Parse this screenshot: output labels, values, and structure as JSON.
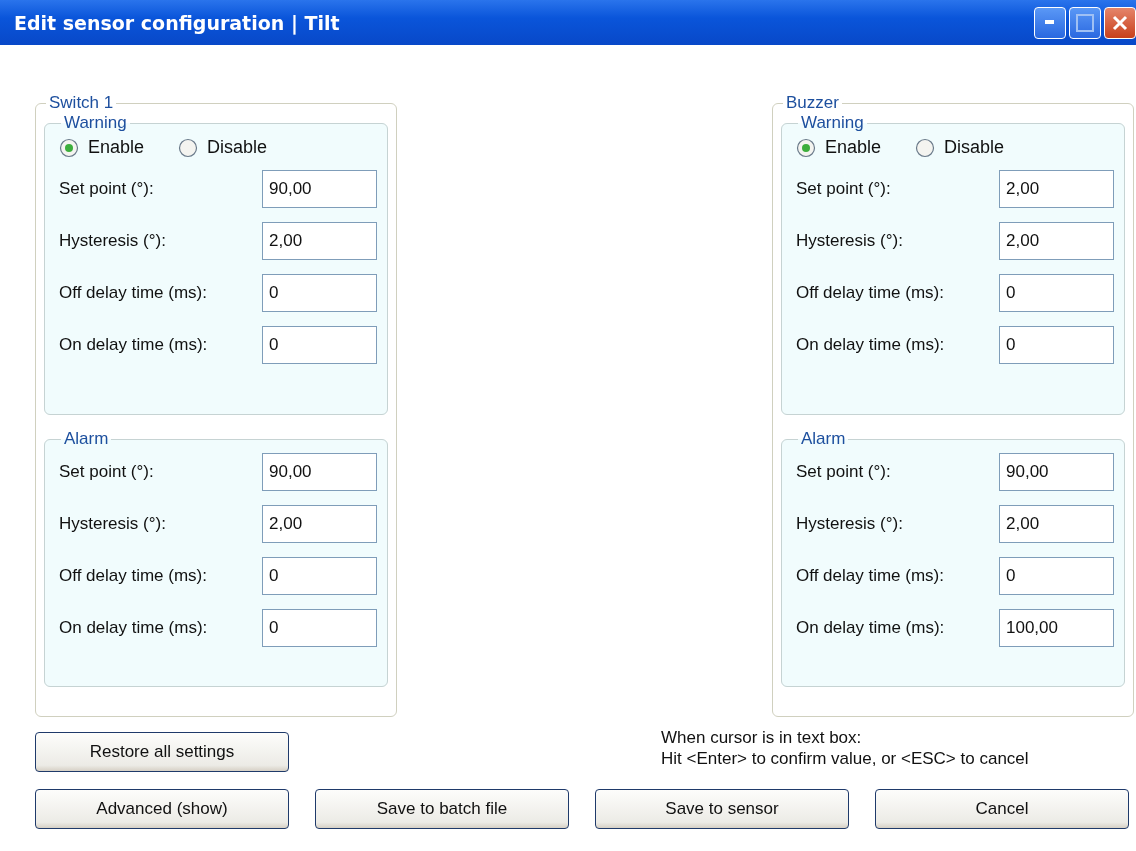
{
  "window": {
    "title": "Edit sensor configuration | Tilt"
  },
  "groups": [
    {
      "title": "Switch 1",
      "sections": [
        {
          "title": "Warning",
          "radios": [
            {
              "label": "Enable",
              "selected": true
            },
            {
              "label": "Disable",
              "selected": false
            }
          ],
          "fields": [
            {
              "label": "Set point (°):",
              "value": "90,00"
            },
            {
              "label": "Hysteresis (°):",
              "value": "2,00"
            },
            {
              "label": "Off delay time (ms):",
              "value": "0"
            },
            {
              "label": "On delay time (ms):",
              "value": "0"
            }
          ]
        },
        {
          "title": "Alarm",
          "fields": [
            {
              "label": "Set point (°):",
              "value": "90,00"
            },
            {
              "label": "Hysteresis (°):",
              "value": "2,00"
            },
            {
              "label": "Off delay time (ms):",
              "value": "0"
            },
            {
              "label": "On delay time (ms):",
              "value": "0"
            }
          ]
        }
      ]
    },
    {
      "title": "Buzzer",
      "sections": [
        {
          "title": "Warning",
          "radios": [
            {
              "label": "Enable",
              "selected": true
            },
            {
              "label": "Disable",
              "selected": false
            }
          ],
          "fields": [
            {
              "label": "Set point (°):",
              "value": "2,00"
            },
            {
              "label": "Hysteresis (°):",
              "value": "2,00"
            },
            {
              "label": "Off delay time (ms):",
              "value": "0"
            },
            {
              "label": "On delay time (ms):",
              "value": "0"
            }
          ]
        },
        {
          "title": "Alarm",
          "fields": [
            {
              "label": "Set point (°):",
              "value": "90,00"
            },
            {
              "label": "Hysteresis (°):",
              "value": "2,00"
            },
            {
              "label": "Off delay time (ms):",
              "value": "0"
            },
            {
              "label": "On delay time (ms):",
              "value": "100,00"
            }
          ]
        }
      ]
    }
  ],
  "restore_button": "Restore all settings",
  "hint": [
    "When cursor is in text box:",
    "Hit <Enter> to confirm value, or <ESC> to cancel"
  ],
  "buttons": [
    "Advanced (show)",
    "Save to batch file",
    "Save to sensor",
    "Cancel"
  ]
}
